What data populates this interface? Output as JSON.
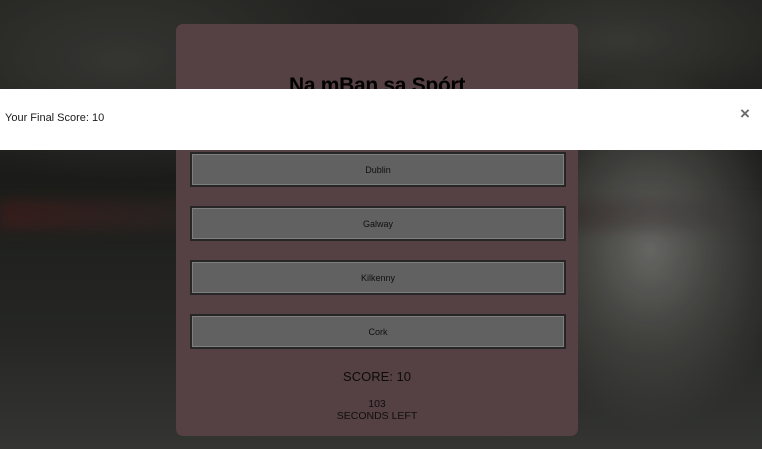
{
  "quiz": {
    "title": "Na mBan sa Spórt",
    "answers": [
      {
        "label": "Dublin"
      },
      {
        "label": "Galway"
      },
      {
        "label": "Kilkenny"
      },
      {
        "label": "Cork"
      }
    ],
    "score_text": "SCORE: 10",
    "timer_value": "103",
    "timer_label": "SECONDS LEFT"
  },
  "modal": {
    "message": "Your Final Score: 10",
    "close_icon": "close-icon"
  },
  "colors": {
    "card_background": "#5d4649",
    "answer_background": "#6a6a6a",
    "modal_background": "#ffffff"
  }
}
